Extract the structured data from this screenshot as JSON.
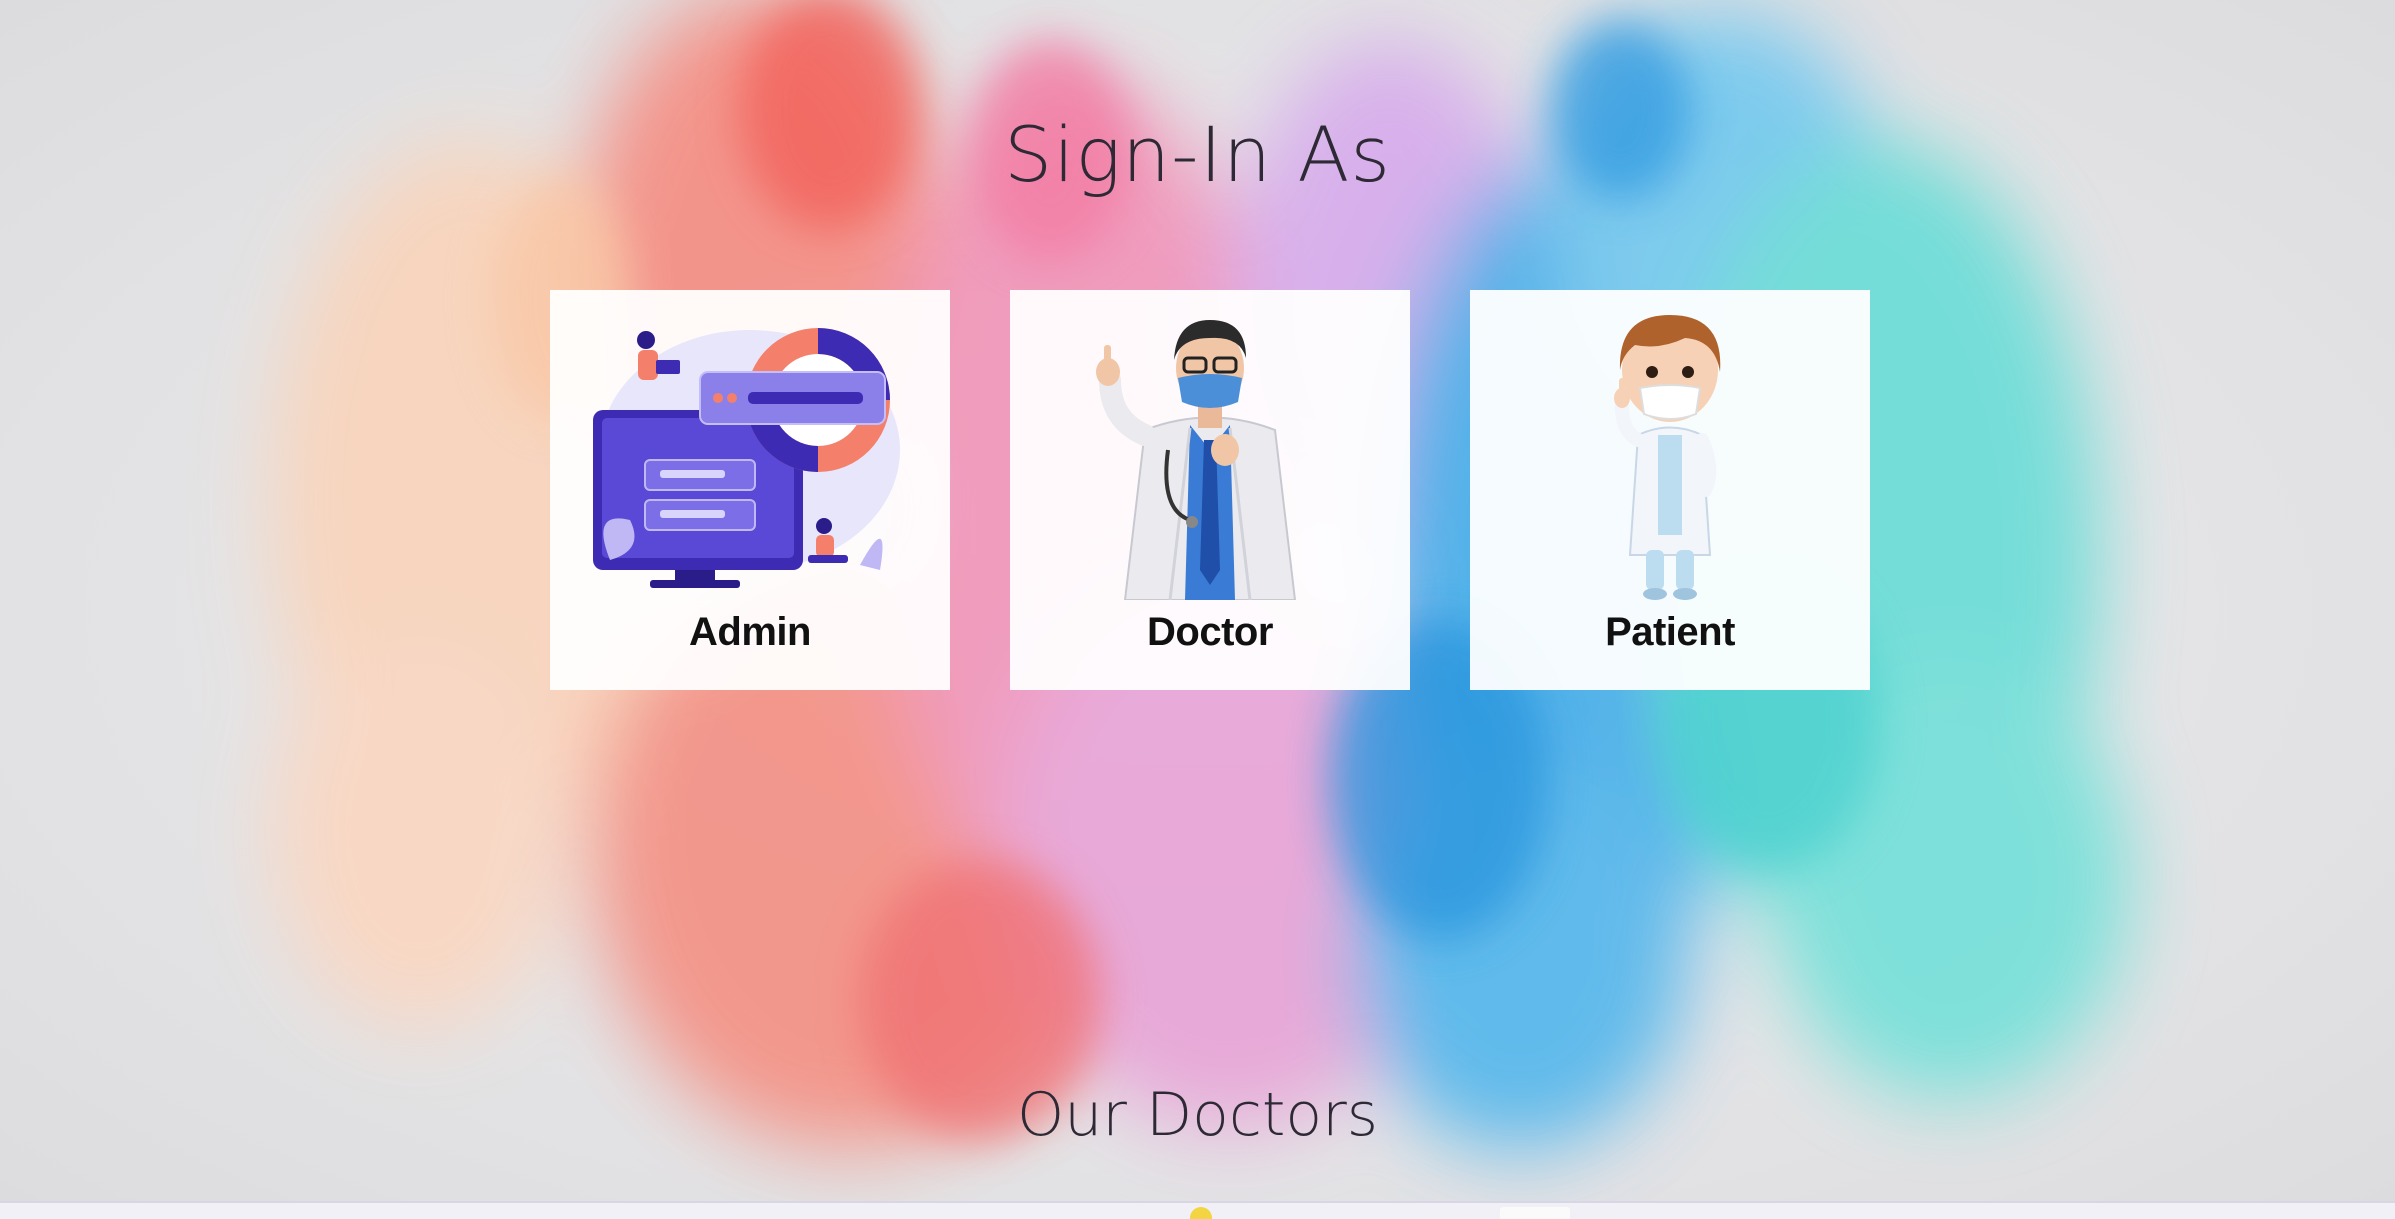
{
  "page": {
    "title": "Sign-In As"
  },
  "roles": [
    {
      "label": "Admin",
      "illustration": "admin-dashboard-illustration"
    },
    {
      "label": "Doctor",
      "illustration": "doctor-3d-illustration"
    },
    {
      "label": "Patient",
      "illustration": "patient-3d-illustration"
    }
  ],
  "sections": {
    "doctors_title": "Our Doctors"
  },
  "colors": {
    "heading": "#2e2a35",
    "card_bg": "#ffffff",
    "accent_coral": "#f47f6b",
    "accent_indigo": "#3d2bb3",
    "accent_teal": "#47d1c9",
    "accent_blue": "#1e9ae0",
    "accent_pink": "#f07aa8"
  }
}
